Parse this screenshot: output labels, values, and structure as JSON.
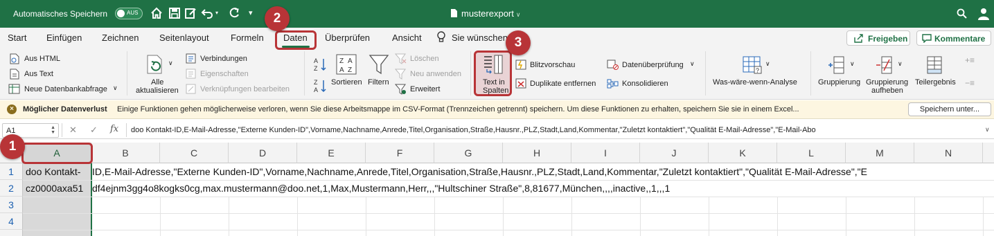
{
  "titlebar": {
    "autosave_label": "Automatisches Speichern",
    "toggle_label": "AUS",
    "doc_title": "musterexport",
    "bg_color": "#1f7145"
  },
  "tabs": [
    {
      "label": "Start"
    },
    {
      "label": "Einfügen"
    },
    {
      "label": "Zeichnen"
    },
    {
      "label": "Seitenlayout"
    },
    {
      "label": "Formeln"
    },
    {
      "label": "Daten"
    },
    {
      "label": "Überprüfen"
    },
    {
      "label": "Ansicht"
    },
    {
      "label": "Sie wünschen"
    }
  ],
  "share_button": "Freigeben",
  "comments_button": "Kommentare",
  "ribbon": {
    "aus_html": "Aus HTML",
    "aus_text": "Aus Text",
    "neue_abfrage": "Neue Datenbankabfrage",
    "alle_aktualisieren_1": "Alle",
    "alle_aktualisieren_2": "aktualisieren",
    "verbindungen": "Verbindungen",
    "eigenschaften": "Eigenschaften",
    "verknuepfungen": "Verknüpfungen bearbeiten",
    "sortieren": "Sortieren",
    "filtern": "Filtern",
    "loeschen": "Löschen",
    "neu_anwenden": "Neu anwenden",
    "erweitert": "Erweitert",
    "text_in_spalten_1": "Text in",
    "text_in_spalten_2": "Spalten",
    "blitzvorschau": "Blitzvorschau",
    "duplikate": "Duplikate entfernen",
    "datenueberpruefung": "Datenüberprüfung",
    "konsolidieren": "Konsolidieren",
    "was_waere_wenn": "Was-wäre-wenn-Analyse",
    "gruppierung": "Gruppierung",
    "gruppierung_aufheben_1": "Gruppierung",
    "gruppierung_aufheben_2": "aufheben",
    "teilergebnis": "Teilergebnis"
  },
  "warning": {
    "title": "Möglicher Datenverlust",
    "text": "Einige Funktionen gehen möglicherweise verloren, wenn Sie diese Arbeitsmappe im CSV-Format (Trennzeichen getrennt) speichern. Um diese Funktionen zu erhalten, speichern Sie sie in einem Excel...",
    "button": "Speichern unter..."
  },
  "formula_bar": {
    "name_box": "A1",
    "fx": "fx",
    "content": "doo Kontakt-ID,E-Mail-Adresse,\"Externe Kunden-ID\",Vorname,Nachname,Anrede,Titel,Organisation,Straße,Hausnr.,PLZ,Stadt,Land,Kommentar,\"Zuletzt kontaktiert\",\"Qualität E-Mail-Adresse\",\"E-Mail-Abo"
  },
  "grid": {
    "columns": [
      "A",
      "B",
      "C",
      "D",
      "E",
      "F",
      "G",
      "H",
      "I",
      "J",
      "K",
      "L",
      "M",
      "N"
    ],
    "rows": [
      "1",
      "2",
      "3",
      "4"
    ],
    "row1_a": "doo Kontakt-",
    "row1_rest": "ID,E-Mail-Adresse,\"Externe Kunden-ID\",Vorname,Nachname,Anrede,Titel,Organisation,Straße,Hausnr.,PLZ,Stadt,Land,Kommentar,\"Zuletzt kontaktiert\",\"Qualität E-Mail-Adresse\",\"E",
    "row2_a": "cz0000axa51",
    "row2_rest": "df4ejnm3gg4o8kogks0cg,max.mustermann@doo.net,1,Max,Mustermann,Herr,,,\"Hultschiner Straße\",8,81677,München,,,,inactive,,1,,,1"
  },
  "annotations": {
    "step1": "1",
    "step2": "2",
    "step3": "3",
    "color": "#b83437"
  }
}
